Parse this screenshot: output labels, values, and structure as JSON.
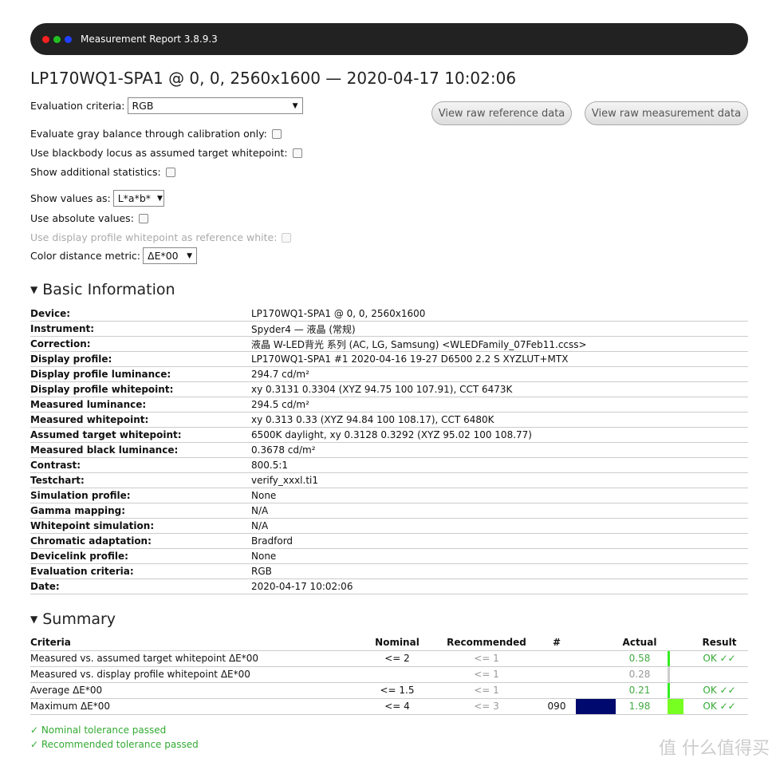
{
  "window": {
    "title": "Measurement Report 3.8.9.3",
    "dots": [
      "#ff2020",
      "#20c020",
      "#2040ff"
    ]
  },
  "page_title": "LP170WQ1-SPA1 @ 0, 0, 2560x1600 — 2020-04-17 10:02:06",
  "controls": {
    "evaluation_criteria_label": "Evaluation criteria:",
    "evaluation_criteria_value": "RGB",
    "gray_balance_label": "Evaluate gray balance through calibration only:",
    "blackbody_label": "Use blackbody locus as assumed target whitepoint:",
    "additional_stats_label": "Show additional statistics:",
    "show_values_label": "Show values as:",
    "show_values_value": "L*a*b*",
    "absolute_label": "Use absolute values:",
    "profile_whitepoint_label": "Use display profile whitepoint as reference white:",
    "distance_metric_label": "Color distance metric:",
    "distance_metric_value": "ΔE*00",
    "view_ref_button": "View raw reference data",
    "view_meas_button": "View raw measurement data"
  },
  "basic": {
    "heading": "Basic Information",
    "rows": [
      [
        "Device:",
        "LP170WQ1-SPA1 @ 0, 0, 2560x1600"
      ],
      [
        "Instrument:",
        "Spyder4 — 液晶 (常规)"
      ],
      [
        "Correction:",
        "液晶 W-LED背光 系列 (AC, LG, Samsung) <WLEDFamily_07Feb11.ccss>"
      ],
      [
        "Display profile:",
        "LP170WQ1-SPA1 #1 2020-04-16 19-27 D6500 2.2 S XYZLUT+MTX"
      ],
      [
        "Display profile luminance:",
        "294.7 cd/m²"
      ],
      [
        "Display profile whitepoint:",
        "xy 0.3131 0.3304 (XYZ 94.75 100 107.91), CCT 6473K"
      ],
      [
        "Measured luminance:",
        "294.5 cd/m²"
      ],
      [
        "Measured whitepoint:",
        "xy 0.313 0.33 (XYZ 94.84 100 108.17), CCT 6480K"
      ],
      [
        "Assumed target whitepoint:",
        "6500K daylight, xy 0.3128 0.3292 (XYZ 95.02 100 108.77)"
      ],
      [
        "Measured black luminance:",
        "0.3678 cd/m²"
      ],
      [
        "Contrast:",
        "800.5:1"
      ],
      [
        "Testchart:",
        "verify_xxxl.ti1"
      ],
      [
        "Simulation profile:",
        "None"
      ],
      [
        "Gamma mapping:",
        "N/A"
      ],
      [
        "Whitepoint simulation:",
        "N/A"
      ],
      [
        "Chromatic adaptation:",
        "Bradford"
      ],
      [
        "Devicelink profile:",
        "None"
      ],
      [
        "Evaluation criteria:",
        "RGB"
      ],
      [
        "Date:",
        "2020-04-17 10:02:06"
      ]
    ]
  },
  "summary": {
    "heading": "Summary",
    "headers": [
      "Criteria",
      "Nominal",
      "Recommended",
      "#",
      "Actual",
      "Result"
    ],
    "rows": [
      {
        "criteria": "Measured vs. assumed target whitepoint ΔE*00",
        "nominal": "<= 2",
        "recommended": "<= 1",
        "num": "",
        "swatch": "",
        "actual": "0.58",
        "bar_color": "#33ee22",
        "bar_fraction": 0.15,
        "result": "OK ✓✓"
      },
      {
        "criteria": "Measured vs. display profile whitepoint ΔE*00",
        "nominal": "",
        "recommended": "<= 1",
        "num": "",
        "swatch": "",
        "actual": "0.28",
        "bar_color": "#cccccc",
        "bar_fraction": 0.1,
        "result": ""
      },
      {
        "criteria": "Average ΔE*00",
        "nominal": "<= 1.5",
        "recommended": "<= 1",
        "num": "",
        "swatch": "",
        "actual": "0.21",
        "bar_color": "#33ee22",
        "bar_fraction": 0.06,
        "result": "OK ✓✓"
      },
      {
        "criteria": "Maximum ΔE*00",
        "nominal": "<= 4",
        "recommended": "<= 3",
        "num": "090",
        "swatch": "#000a6e",
        "actual": "1.98",
        "bar_color": "#77ff22",
        "bar_fraction": 1,
        "result": "OK ✓✓"
      }
    ],
    "nominal_passed": "✓ Nominal tolerance passed",
    "recommended_passed": "✓ Recommended tolerance passed"
  },
  "watermark": "值 什么值得买"
}
